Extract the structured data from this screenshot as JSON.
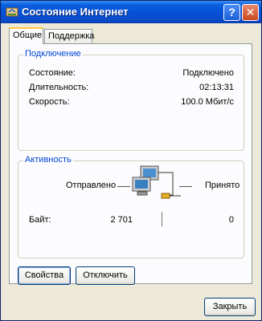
{
  "window": {
    "title": "Состояние Интернет"
  },
  "titlebar": {
    "help_label": "?",
    "close_label": "✕"
  },
  "tabs": [
    {
      "label": "Общие"
    },
    {
      "label": "Поддержка"
    }
  ],
  "connection": {
    "title": "Подключение",
    "rows": [
      {
        "label": "Состояние:",
        "value": "Подключено"
      },
      {
        "label": "Длительность:",
        "value": "02:13:31"
      },
      {
        "label": "Скорость:",
        "value": "100.0 Мбит/с"
      }
    ]
  },
  "activity": {
    "title": "Активность",
    "sent_label": "Отправлено",
    "received_label": "Принято",
    "bytes_label": "Байт:",
    "bytes_sent": "2 701",
    "bytes_received": "0"
  },
  "buttons": {
    "properties": "Свойства",
    "disconnect": "Отключить",
    "close": "Закрыть"
  }
}
